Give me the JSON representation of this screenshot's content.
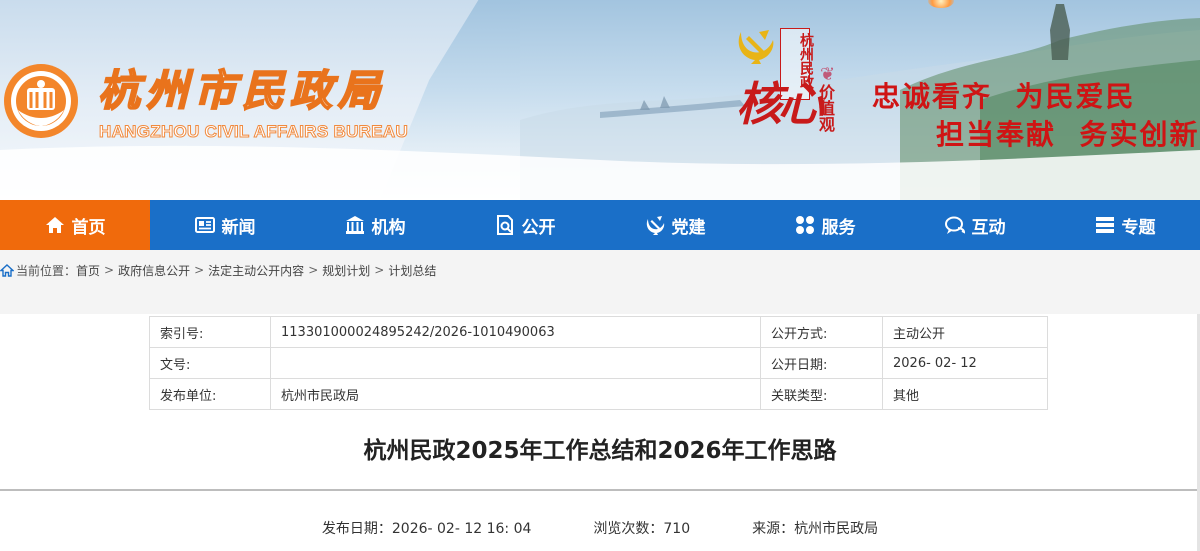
{
  "header": {
    "logo_cn": "杭州市民政局",
    "logo_en": "HANGZHOU CIVIL AFFAIRS BUREAU",
    "campaign_vertical": "杭州民政",
    "campaign_core": "核心",
    "campaign_values": "价值观",
    "slogan_line1": "忠诚看齐  为民爱民",
    "slogan_line2": "担当奉献  务实创新"
  },
  "nav": {
    "items": [
      {
        "label": "首页",
        "icon": "home-icon"
      },
      {
        "label": "新闻",
        "icon": "news-icon"
      },
      {
        "label": "机构",
        "icon": "institution-icon"
      },
      {
        "label": "公开",
        "icon": "disclosure-icon"
      },
      {
        "label": "党建",
        "icon": "party-icon"
      },
      {
        "label": "服务",
        "icon": "service-icon"
      },
      {
        "label": "互动",
        "icon": "chat-icon"
      },
      {
        "label": "专题",
        "icon": "topic-icon"
      }
    ],
    "active_index": 0
  },
  "breadcrumb": {
    "prefix": "当前位置：",
    "items": [
      "首页",
      "政府信息公开",
      "法定主动公开内容",
      "规划计划",
      "计划总结"
    ],
    "separator": ">"
  },
  "meta": {
    "rows": [
      {
        "k1": "索引号:",
        "v1": "113301000024895242/2026-1010490063",
        "k2": "公开方式:",
        "v2": "主动公开"
      },
      {
        "k1": "文号:",
        "v1": "",
        "k2": "公开日期:",
        "v2": "2026- 02- 12"
      },
      {
        "k1": "发布单位:",
        "v1": "杭州市民政局",
        "k2": "关联类型:",
        "v2": "其他"
      }
    ]
  },
  "article": {
    "title": "杭州民政2025年工作总结和2026年工作思路",
    "publish_label": "发布日期：",
    "publish_value": "2026- 02- 12 16: 04",
    "views_label": "浏览次数：",
    "views_value": "710",
    "source_label": "来源：",
    "source_value": "杭州市民政局"
  },
  "colors": {
    "nav_bg": "#1a6fc8",
    "nav_active": "#f06a0c",
    "brand_orange": "#e9731c",
    "slogan_red": "#cf1414"
  }
}
